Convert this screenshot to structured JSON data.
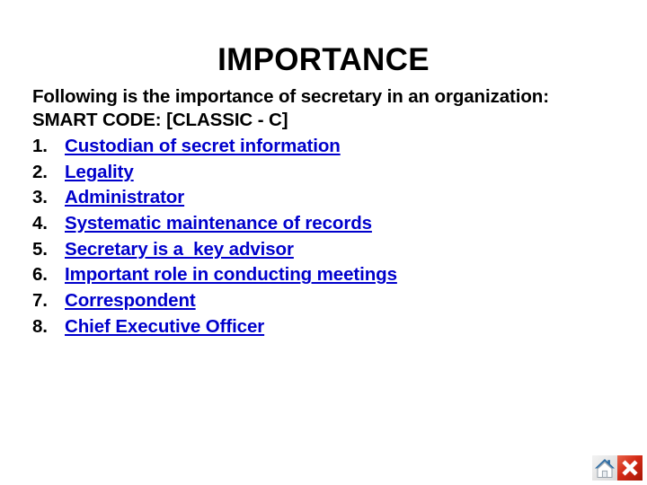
{
  "slide": {
    "title": "IMPORTANCE",
    "intro_lines": [
      "Following is the importance of secretary in an organization:",
      "SMART CODE: [CLASSIC - C]"
    ],
    "list_items": [
      {
        "number": "1.",
        "label": "Custodian of secret information"
      },
      {
        "number": "2.",
        "label": "Legality"
      },
      {
        "number": "3.",
        "label": "Administrator"
      },
      {
        "number": "4.",
        "label": "Systematic maintenance of records"
      },
      {
        "number": "5.",
        "label": "Secretary is a  key advisor"
      },
      {
        "number": "6.",
        "label": "Important role in conducting meetings"
      },
      {
        "number": "7.",
        "label": "Correspondent"
      },
      {
        "number": "8.",
        "label": "Chief Executive Officer"
      }
    ]
  },
  "nav": {
    "home_icon": "home-icon",
    "close_icon": "close-x-icon"
  },
  "colors": {
    "link": "#0000CC",
    "text": "#000000",
    "background": "#FFFFFF",
    "close_button": "#D42A16",
    "home_roof": "#2E6DA4"
  }
}
